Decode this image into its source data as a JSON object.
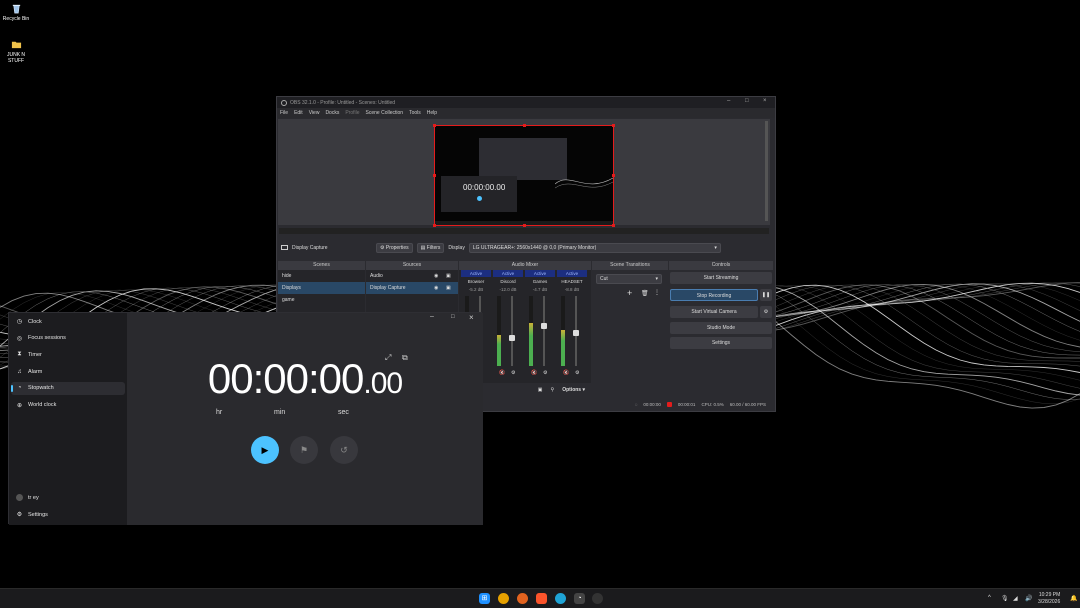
{
  "desktop": {
    "icons": [
      {
        "label": "Recycle Bin",
        "icon": "recycle-bin-icon"
      },
      {
        "label": "JUNK N STUFF",
        "icon": "folder-icon"
      }
    ]
  },
  "obs": {
    "title": "OBS 32.1.0 - Profile: Untitled - Scenes: Untitled",
    "menu": [
      "File",
      "Edit",
      "View",
      "Docks",
      "Profile",
      "Scene Collection",
      "Tools",
      "Help"
    ],
    "preview": {
      "timer_text": "00:00:00.00"
    },
    "source_bar": {
      "selected_source": "Display Capture",
      "properties_label": "Properties",
      "filters_label": "Filters",
      "display_label": "Display",
      "display_value": "LG ULTRAGEAR+: 2560x1440 @ 0,0 (Primary Monitor)"
    },
    "docks": {
      "scenes": {
        "title": "Scenes",
        "items": [
          "hide",
          "Displays",
          "game"
        ],
        "selected": 1
      },
      "sources": {
        "title": "Sources",
        "items": [
          "Audio",
          "Display Capture"
        ],
        "selected": 1
      },
      "mixer": {
        "title": "Audio Mixer",
        "channels": [
          {
            "status": "Active",
            "name": "Browser",
            "db": "-5.2 dB",
            "level": 0.6
          },
          {
            "status": "Active",
            "name": "Discord",
            "db": "-12.0 dB",
            "level": 0.45
          },
          {
            "status": "Active",
            "name": "Games",
            "db": "-4.7 dB",
            "level": 0.62
          },
          {
            "status": "Active",
            "name": "HEADSET",
            "db": "-8.8 dB",
            "level": 0.52
          }
        ],
        "options_label": "Options"
      },
      "transitions": {
        "title": "Scene Transitions",
        "value": "Cut"
      },
      "controls": {
        "title": "Controls",
        "buttons": [
          "Start Streaming",
          "Stop Recording",
          "Start Virtual Camera",
          "Studio Mode",
          "Settings"
        ]
      }
    },
    "status": {
      "stream_time": "00:00:00",
      "rec_time": "00:00:01",
      "cpu": "CPU: 0.5%",
      "fps": "60.00 / 60.00 FPS"
    },
    "colors": {
      "accent": "#294866",
      "record": "#e41c1c"
    }
  },
  "clock": {
    "nav": [
      {
        "label": "Clock",
        "icon": "clock-icon",
        "glyph": "◷"
      },
      {
        "label": "Focus sessions",
        "icon": "focus-icon",
        "glyph": "◎"
      },
      {
        "label": "Timer",
        "icon": "hourglass-icon",
        "glyph": "⧗"
      },
      {
        "label": "Alarm",
        "icon": "bell-icon",
        "glyph": "♫"
      },
      {
        "label": "Stopwatch",
        "icon": "stopwatch-icon",
        "glyph": "◔"
      },
      {
        "label": "World clock",
        "icon": "globe-icon",
        "glyph": "⊕"
      }
    ],
    "selected_index": 4,
    "user": "tr ey",
    "settings_label": "Settings",
    "stopwatch": {
      "main": "00:00:00",
      "fraction": ".00",
      "units": [
        "hr",
        "min",
        "sec"
      ]
    },
    "accent": "#4cc2ff"
  },
  "taskbar": {
    "time": "10:29 PM",
    "date": "3/28/2026"
  }
}
